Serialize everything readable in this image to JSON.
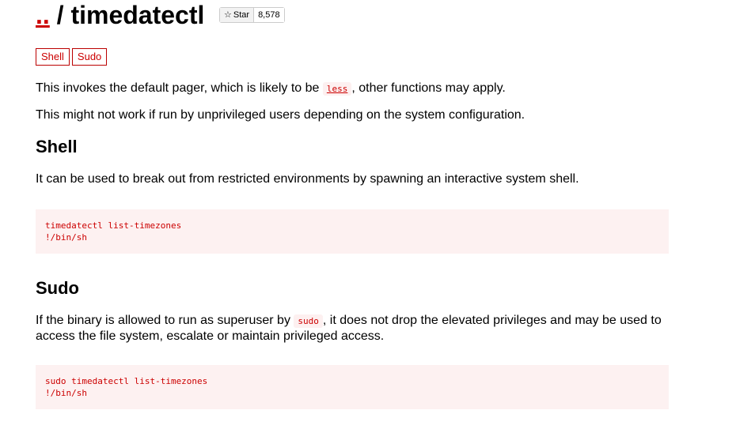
{
  "header": {
    "parent_link": "..",
    "separator": "/",
    "title": "timedatectl",
    "star_label": "Star",
    "star_count": "8,578"
  },
  "tags": [
    "Shell",
    "Sudo"
  ],
  "intro": {
    "p1_before": "This invokes the default pager, which is likely to be ",
    "p1_code": "less",
    "p1_after": ", other functions may apply.",
    "p2": "This might not work if run by unprivileged users depending on the system configuration."
  },
  "shell": {
    "heading": "Shell",
    "text": "It can be used to break out from restricted environments by spawning an interactive system shell.",
    "code": "timedatectl list-timezones\n!/bin/sh"
  },
  "sudo": {
    "heading": "Sudo",
    "text_before": "If the binary is allowed to run as superuser by ",
    "text_code": "sudo",
    "text_after": ", it does not drop the elevated privileges and may be used to access the file system, escalate or maintain privileged access.",
    "code": "sudo timedatectl list-timezones\n!/bin/sh"
  }
}
